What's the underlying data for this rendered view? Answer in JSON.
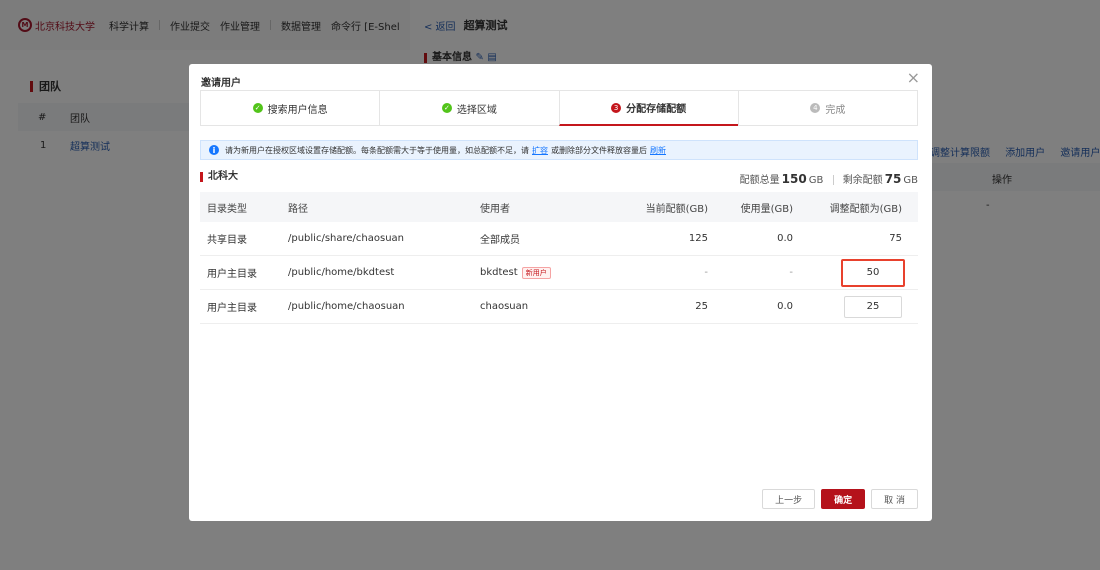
{
  "nav": {
    "logo_text": "北京科技大学",
    "items": [
      "科学计算",
      "作业提交",
      "作业管理",
      "数据管理",
      "命令行 [E-Shel"
    ]
  },
  "left": {
    "title": "团队",
    "columns": [
      "#",
      "团队"
    ],
    "rows": [
      {
        "index": "1",
        "name": "超算测试"
      }
    ]
  },
  "right": {
    "back": "< 返回",
    "title": "超算测试",
    "section": "基本信息",
    "actions": [
      "调整计算限额",
      "添加用户",
      "邀请用户"
    ],
    "op_header": "操作",
    "op_value": "-"
  },
  "modal": {
    "title": "邀请用户",
    "close": "×",
    "steps": [
      {
        "label": "搜索用户信息",
        "state": "done",
        "icon": "✓"
      },
      {
        "label": "选择区域",
        "state": "done",
        "icon": "✓"
      },
      {
        "label": "分配存储配额",
        "state": "active",
        "icon": "3"
      },
      {
        "label": "完成",
        "state": "todo",
        "icon": "4"
      }
    ],
    "alert": {
      "text_before": "请为新用户在授权区域设置存储配额。每条配额需大于等于使用量，如总配额不足，请",
      "link1": "扩容",
      "text_mid": "或删除部分文件释放容量后",
      "link2": "刷新"
    },
    "region": "北科大",
    "quota": {
      "total_label": "配额总量",
      "total_value": "150",
      "unit": "GB",
      "remain_label": "剩余配额",
      "remain_value": "75"
    },
    "table": {
      "headers": [
        "目录类型",
        "路径",
        "使用者",
        "当前配额(GB)",
        "使用量(GB)",
        "调整配额为(GB)"
      ],
      "rows": [
        {
          "type": "共享目录",
          "path": "/public/share/chaosuan",
          "user": "全部成员",
          "tag": "",
          "current": "125",
          "used": "0.0",
          "adjust": "75"
        },
        {
          "type": "用户主目录",
          "path": "/public/home/bkdtest",
          "user": "bkdtest",
          "tag": "新用户",
          "current": "-",
          "used": "-",
          "adjust": "50"
        },
        {
          "type": "用户主目录",
          "path": "/public/home/chaosuan",
          "user": "chaosuan",
          "tag": "",
          "current": "25",
          "used": "0.0",
          "adjust": "25"
        }
      ]
    },
    "buttons": {
      "prev": "上一步",
      "ok": "确定",
      "cancel": "取 消"
    }
  }
}
